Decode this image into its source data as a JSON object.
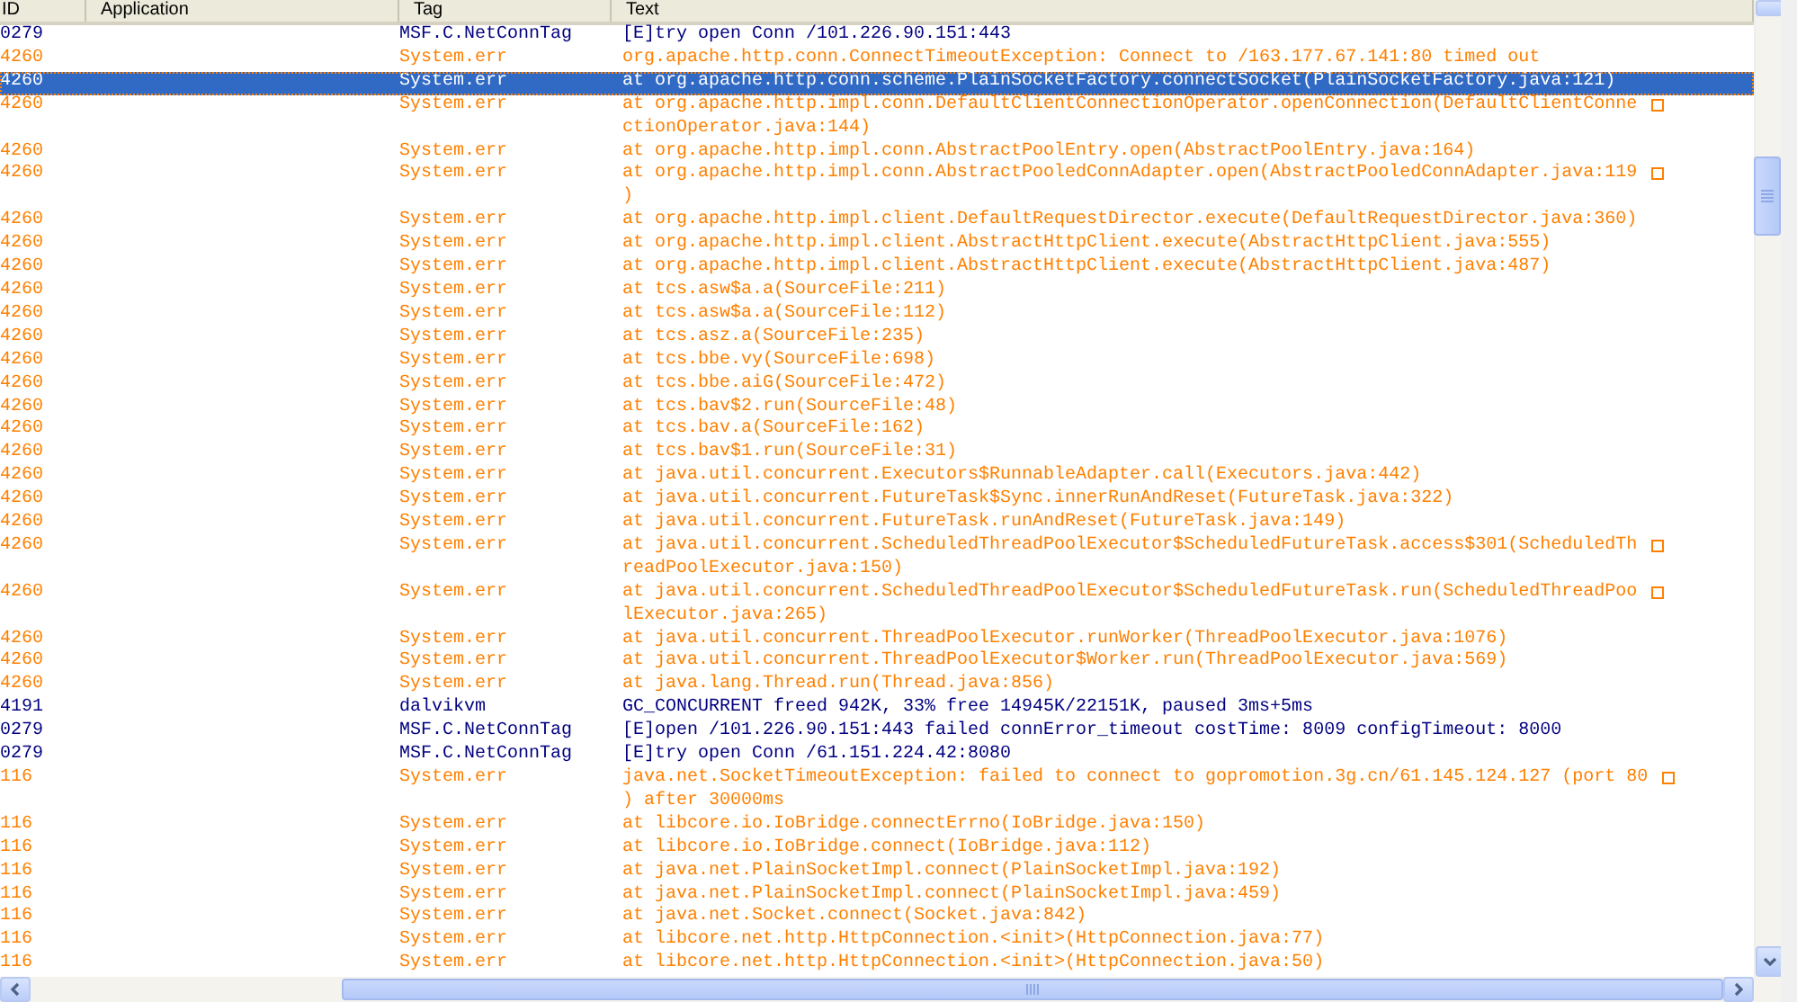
{
  "columns": [
    "ID",
    "Application",
    "Tag",
    "Text"
  ],
  "rows": [
    {
      "id": "0279",
      "tag": "MSF.C.NetConnTag",
      "color": "#000080",
      "selected": false,
      "lines": [
        "[E]try open Conn /101.226.90.151:443"
      ]
    },
    {
      "id": "4260",
      "tag": "System.err",
      "color": "#ff8000",
      "selected": false,
      "lines": [
        "org.apache.http.conn.ConnectTimeoutException: Connect to /163.177.67.141:80 timed out"
      ]
    },
    {
      "id": "4260",
      "tag": "System.err",
      "color": "#ff8000",
      "selected": true,
      "lines": [
        "at org.apache.http.conn.scheme.PlainSocketFactory.connectSocket(PlainSocketFactory.java:121)"
      ]
    },
    {
      "id": "4260",
      "tag": "System.err",
      "color": "#ff8000",
      "selected": false,
      "lines": [
        "at org.apache.http.impl.conn.DefaultClientConnectionOperator.openConnection(DefaultClientConne",
        "ctionOperator.java:144)"
      ]
    },
    {
      "id": "4260",
      "tag": "System.err",
      "color": "#ff8000",
      "selected": false,
      "lines": [
        "at org.apache.http.impl.conn.AbstractPoolEntry.open(AbstractPoolEntry.java:164)"
      ]
    },
    {
      "id": "4260",
      "tag": "System.err",
      "color": "#ff8000",
      "selected": false,
      "lines": [
        "at org.apache.http.impl.conn.AbstractPooledConnAdapter.open(AbstractPooledConnAdapter.java:119",
        ")"
      ]
    },
    {
      "id": "4260",
      "tag": "System.err",
      "color": "#ff8000",
      "selected": false,
      "lines": [
        "at org.apache.http.impl.client.DefaultRequestDirector.execute(DefaultRequestDirector.java:360)"
      ]
    },
    {
      "id": "4260",
      "tag": "System.err",
      "color": "#ff8000",
      "selected": false,
      "lines": [
        "at org.apache.http.impl.client.AbstractHttpClient.execute(AbstractHttpClient.java:555)"
      ]
    },
    {
      "id": "4260",
      "tag": "System.err",
      "color": "#ff8000",
      "selected": false,
      "lines": [
        "at org.apache.http.impl.client.AbstractHttpClient.execute(AbstractHttpClient.java:487)"
      ]
    },
    {
      "id": "4260",
      "tag": "System.err",
      "color": "#ff8000",
      "selected": false,
      "lines": [
        "at tcs.asw$a.a(SourceFile:211)"
      ]
    },
    {
      "id": "4260",
      "tag": "System.err",
      "color": "#ff8000",
      "selected": false,
      "lines": [
        "at tcs.asw$a.a(SourceFile:112)"
      ]
    },
    {
      "id": "4260",
      "tag": "System.err",
      "color": "#ff8000",
      "selected": false,
      "lines": [
        "at tcs.asz.a(SourceFile:235)"
      ]
    },
    {
      "id": "4260",
      "tag": "System.err",
      "color": "#ff8000",
      "selected": false,
      "lines": [
        "at tcs.bbe.vy(SourceFile:698)"
      ]
    },
    {
      "id": "4260",
      "tag": "System.err",
      "color": "#ff8000",
      "selected": false,
      "lines": [
        "at tcs.bbe.aiG(SourceFile:472)"
      ]
    },
    {
      "id": "4260",
      "tag": "System.err",
      "color": "#ff8000",
      "selected": false,
      "lines": [
        "at tcs.bav$2.run(SourceFile:48)"
      ]
    },
    {
      "id": "4260",
      "tag": "System.err",
      "color": "#ff8000",
      "selected": false,
      "lines": [
        "at tcs.bav.a(SourceFile:162)"
      ]
    },
    {
      "id": "4260",
      "tag": "System.err",
      "color": "#ff8000",
      "selected": false,
      "lines": [
        "at tcs.bav$1.run(SourceFile:31)"
      ]
    },
    {
      "id": "4260",
      "tag": "System.err",
      "color": "#ff8000",
      "selected": false,
      "lines": [
        "at java.util.concurrent.Executors$RunnableAdapter.call(Executors.java:442)"
      ]
    },
    {
      "id": "4260",
      "tag": "System.err",
      "color": "#ff8000",
      "selected": false,
      "lines": [
        "at java.util.concurrent.FutureTask$Sync.innerRunAndReset(FutureTask.java:322)"
      ]
    },
    {
      "id": "4260",
      "tag": "System.err",
      "color": "#ff8000",
      "selected": false,
      "lines": [
        "at java.util.concurrent.FutureTask.runAndReset(FutureTask.java:149)"
      ]
    },
    {
      "id": "4260",
      "tag": "System.err",
      "color": "#ff8000",
      "selected": false,
      "lines": [
        "at java.util.concurrent.ScheduledThreadPoolExecutor$ScheduledFutureTask.access$301(ScheduledTh",
        "readPoolExecutor.java:150)"
      ]
    },
    {
      "id": "4260",
      "tag": "System.err",
      "color": "#ff8000",
      "selected": false,
      "lines": [
        "at java.util.concurrent.ScheduledThreadPoolExecutor$ScheduledFutureTask.run(ScheduledThreadPoo",
        "lExecutor.java:265)"
      ]
    },
    {
      "id": "4260",
      "tag": "System.err",
      "color": "#ff8000",
      "selected": false,
      "lines": [
        "at java.util.concurrent.ThreadPoolExecutor.runWorker(ThreadPoolExecutor.java:1076)"
      ]
    },
    {
      "id": "4260",
      "tag": "System.err",
      "color": "#ff8000",
      "selected": false,
      "lines": [
        "at java.util.concurrent.ThreadPoolExecutor$Worker.run(ThreadPoolExecutor.java:569)"
      ]
    },
    {
      "id": "4260",
      "tag": "System.err",
      "color": "#ff8000",
      "selected": false,
      "lines": [
        "at java.lang.Thread.run(Thread.java:856)"
      ]
    },
    {
      "id": "4191",
      "tag": "dalvikvm",
      "color": "#000080",
      "selected": false,
      "lines": [
        "GC_CONCURRENT freed 942K, 33% free 14945K/22151K, paused 3ms+5ms"
      ]
    },
    {
      "id": "0279",
      "tag": "MSF.C.NetConnTag",
      "color": "#000080",
      "selected": false,
      "lines": [
        "[E]open /101.226.90.151:443 failed connError_timeout costTime: 8009 configTimeout: 8000"
      ]
    },
    {
      "id": "0279",
      "tag": "MSF.C.NetConnTag",
      "color": "#000080",
      "selected": false,
      "lines": [
        "[E]try open Conn /61.151.224.42:8080"
      ]
    },
    {
      "id": "116",
      "tag": "System.err",
      "color": "#ff8000",
      "selected": false,
      "lines": [
        "java.net.SocketTimeoutException: failed to connect to gopromotion.3g.cn/61.145.124.127 (port 80",
        ") after 30000ms"
      ]
    },
    {
      "id": "116",
      "tag": "System.err",
      "color": "#ff8000",
      "selected": false,
      "lines": [
        "at libcore.io.IoBridge.connectErrno(IoBridge.java:150)"
      ]
    },
    {
      "id": "116",
      "tag": "System.err",
      "color": "#ff8000",
      "selected": false,
      "lines": [
        "at libcore.io.IoBridge.connect(IoBridge.java:112)"
      ]
    },
    {
      "id": "116",
      "tag": "System.err",
      "color": "#ff8000",
      "selected": false,
      "lines": [
        "at java.net.PlainSocketImpl.connect(PlainSocketImpl.java:192)"
      ]
    },
    {
      "id": "116",
      "tag": "System.err",
      "color": "#ff8000",
      "selected": false,
      "lines": [
        "at java.net.PlainSocketImpl.connect(PlainSocketImpl.java:459)"
      ]
    },
    {
      "id": "116",
      "tag": "System.err",
      "color": "#ff8000",
      "selected": false,
      "lines": [
        "at java.net.Socket.connect(Socket.java:842)"
      ]
    },
    {
      "id": "116",
      "tag": "System.err",
      "color": "#ff8000",
      "selected": false,
      "lines": [
        "at libcore.net.http.HttpConnection.<init>(HttpConnection.java:77)"
      ]
    },
    {
      "id": "116",
      "tag": "System.err",
      "color": "#ff8000",
      "selected": false,
      "lines": [
        "at libcore.net.http.HttpConnection.<init>(HttpConnection.java:50)"
      ]
    }
  ]
}
